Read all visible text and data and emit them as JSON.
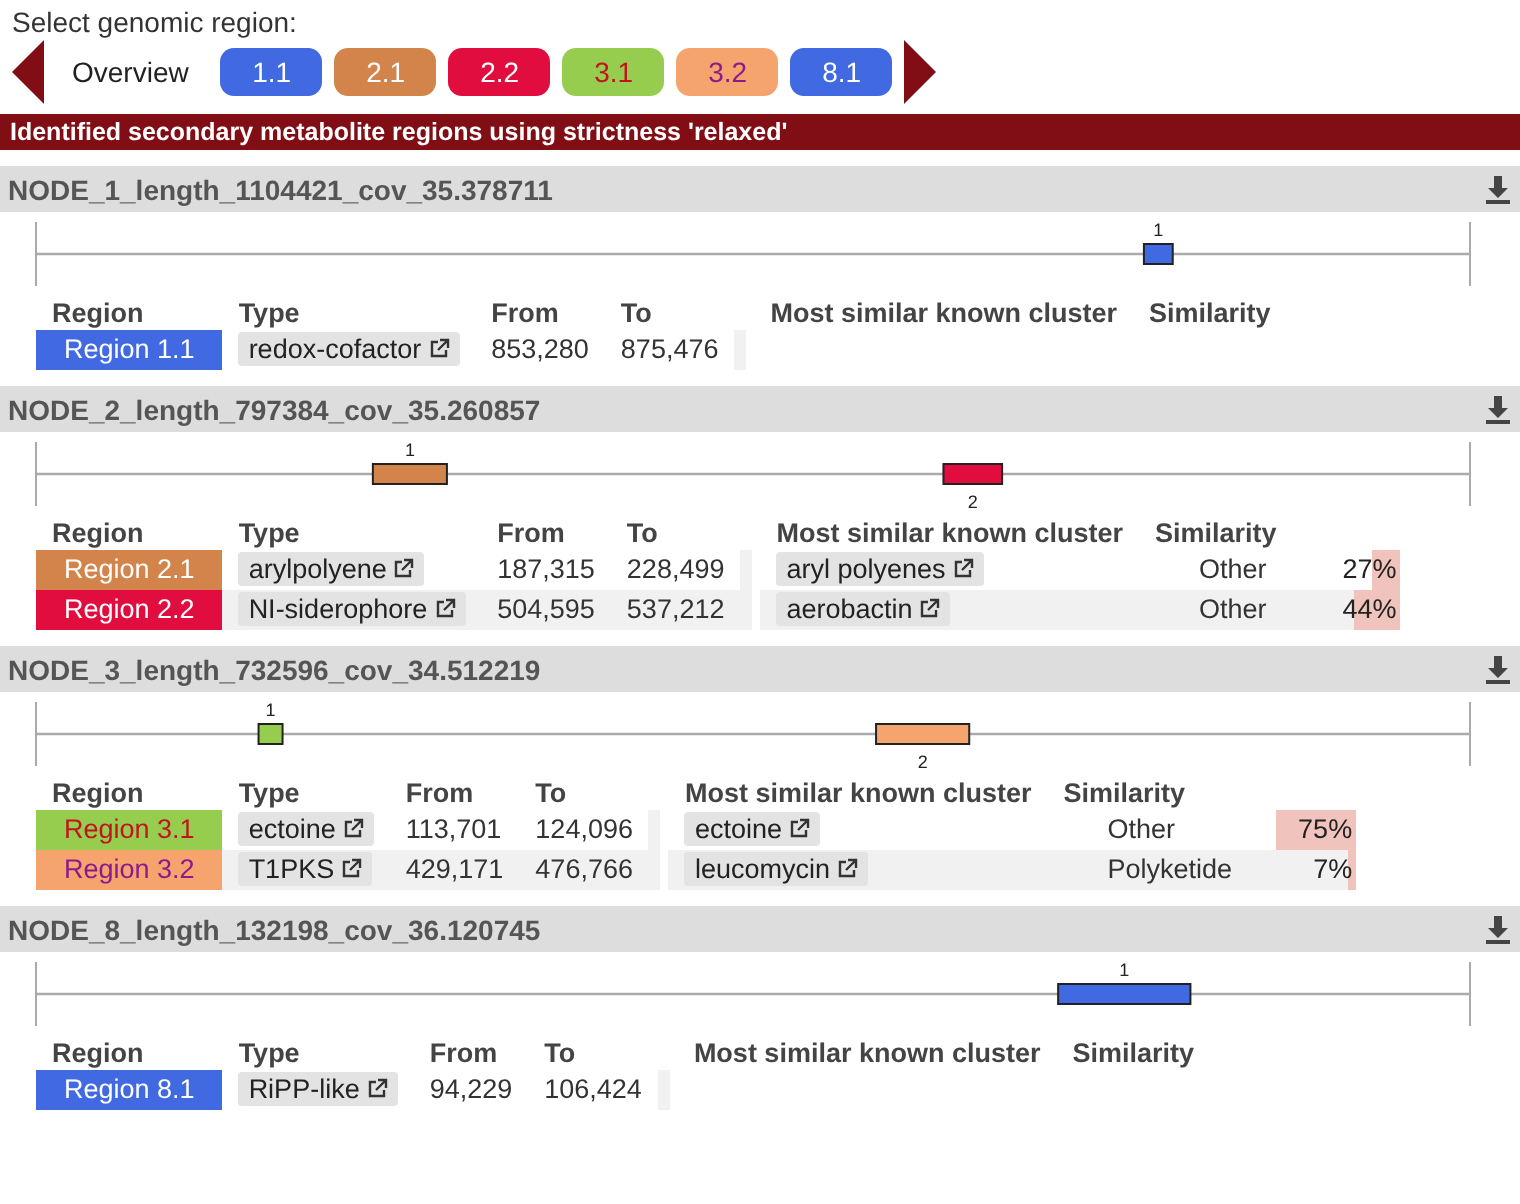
{
  "nav": {
    "label": "Select genomic region:",
    "overview": "Overview",
    "buttons": [
      {
        "label": "1.1",
        "color": "#4169e1"
      },
      {
        "label": "2.1",
        "color": "#d2844b"
      },
      {
        "label": "2.2",
        "color": "#e00d3e"
      },
      {
        "label": "3.1",
        "color": "#97cd4f"
      },
      {
        "label": "3.2",
        "color": "#f5a46e"
      },
      {
        "label": "8.1",
        "color": "#4169e1"
      }
    ]
  },
  "banner": "Identified secondary metabolite regions using strictness 'relaxed'",
  "records": [
    {
      "name": "NODE_1_length_1104421_cov_35.378711",
      "columns": [
        "Region",
        "Type",
        "From",
        "To",
        "Most similar known cluster",
        "Similarity"
      ],
      "regions": [
        {
          "label": "Region 1.1",
          "color": "#4169e1",
          "marker": "1",
          "type": "redox-cofactor",
          "from": "853,280",
          "to": "875,476"
        }
      ]
    },
    {
      "name": "NODE_2_length_797384_cov_35.260857",
      "columns": [
        "Region",
        "Type",
        "From",
        "To",
        "Most similar known cluster",
        "Similarity"
      ],
      "regions": [
        {
          "label": "Region 2.1",
          "color": "#d2844b",
          "marker": "1",
          "type": "arylpolyene",
          "from": "187,315",
          "to": "228,499",
          "cluster": "aryl polyenes",
          "cluster_type": "Other",
          "similarity": "27%",
          "level": 0.27
        },
        {
          "label": "Region 2.2",
          "color": "#e00d3e",
          "marker": "2",
          "type": "NI-siderophore",
          "from": "504,595",
          "to": "537,212",
          "cluster": "aerobactin",
          "cluster_type": "Other",
          "similarity": "44%",
          "level": 0.44
        }
      ]
    },
    {
      "name": "NODE_3_length_732596_cov_34.512219",
      "columns": [
        "Region",
        "Type",
        "From",
        "To",
        "Most similar known cluster",
        "Similarity"
      ],
      "regions": [
        {
          "label": "Region 3.1",
          "color": "#97cd4f",
          "marker": "1",
          "type": "ectoine",
          "from": "113,701",
          "to": "124,096",
          "cluster": "ectoine",
          "cluster_type": "Other",
          "similarity": "75%",
          "level": 0.75
        },
        {
          "label": "Region 3.2",
          "color": "#f5a46e",
          "marker": "2",
          "type": "T1PKS",
          "from": "429,171",
          "to": "476,766",
          "cluster": "leucomycin",
          "cluster_type": "Polyketide",
          "similarity": "7%",
          "level": 0.07
        }
      ]
    },
    {
      "name": "NODE_8_length_132198_cov_36.120745",
      "columns": [
        "Region",
        "Type",
        "From",
        "To",
        "Most similar known cluster",
        "Similarity"
      ],
      "regions": [
        {
          "label": "Region 8.1",
          "color": "#4169e1",
          "marker": "1",
          "type": "RiPP-like",
          "from": "94,229",
          "to": "106,424"
        }
      ]
    }
  ]
}
